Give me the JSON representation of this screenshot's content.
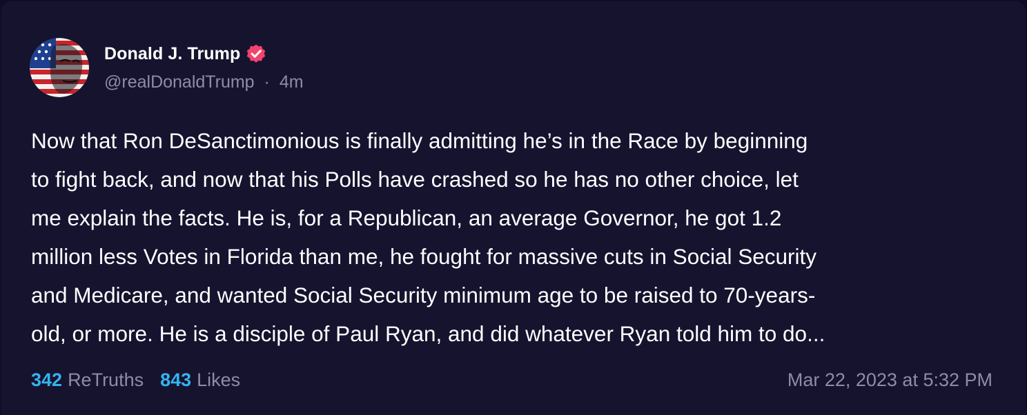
{
  "post": {
    "author_name": "Donald J. Trump",
    "handle": "@realDonaldTrump",
    "separator": "·",
    "relative_time": "4m",
    "body": "Now that Ron DeSanctimonious is finally admitting he’s in the Race by beginning\nto fight back, and now that his Polls have crashed so he has no other choice, let\nme explain the facts. He is, for a Republican, an average Governor, he got 1.2\nmillion less Votes in Florida than me, he fought for massive cuts in Social Security\nand Medicare, and wanted Social Security minimum age to be raised to 70-years-\nold, or more. He is a disciple of Paul Ryan, and did whatever Ryan told him to do...",
    "retruths_count": "342",
    "retruths_label": "ReTruths",
    "likes_count": "843",
    "likes_label": "Likes",
    "timestamp": "Mar 22, 2023 at 5:32 PM"
  },
  "icons": {
    "avatar": "avatar-flag-portrait",
    "verified": "verified-badge-icon"
  },
  "colors": {
    "card_background": "#16132f",
    "page_background": "#0f0d24",
    "text_primary": "#ffffff",
    "text_secondary": "#8f8ca6",
    "stat_accent": "#34b4ef",
    "verified_badge": "#f0436e"
  }
}
